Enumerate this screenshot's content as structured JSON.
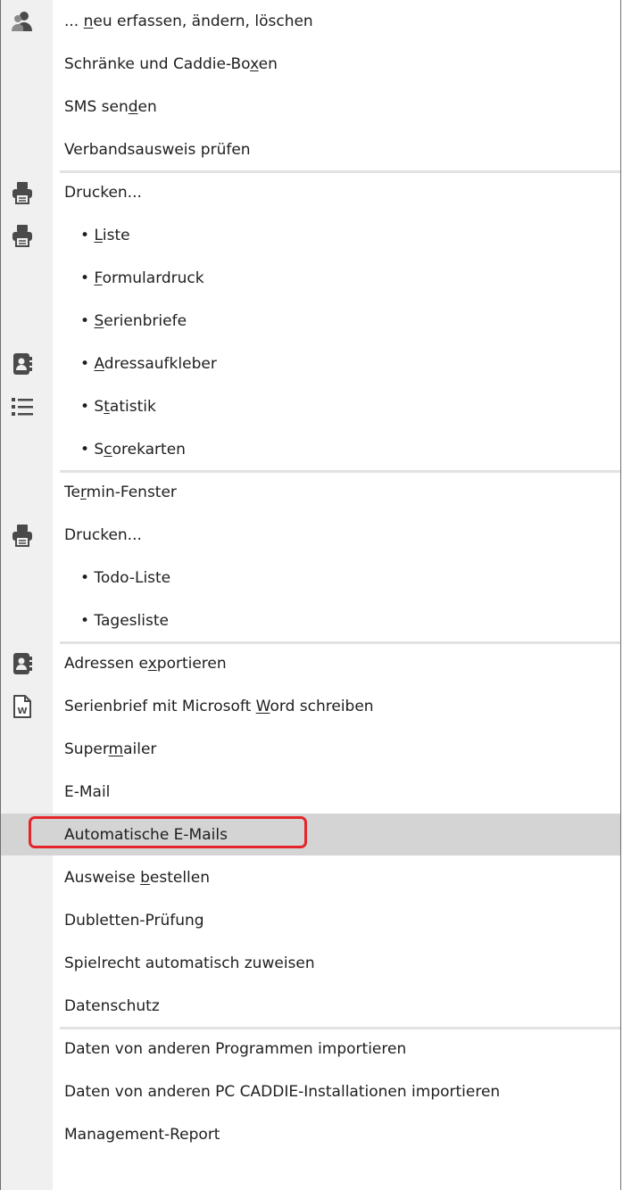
{
  "menu": {
    "items": [
      {
        "pre": "... ",
        "u": "n",
        "post": "eu erfassen, ändern, löschen",
        "icon": "users-icon"
      },
      {
        "pre": "Schränke und Caddie-Bo",
        "u": "x",
        "post": "en"
      },
      {
        "pre": "SMS sen",
        "u": "d",
        "post": "en"
      },
      {
        "pre": "Verbandsausweis prüfen",
        "u": "",
        "post": ""
      },
      {
        "pre": "Drucken...",
        "u": "",
        "post": "",
        "icon": "printer-icon",
        "sep_before": true
      },
      {
        "pre": "• ",
        "u": "L",
        "post": "iste",
        "icon": "printer-icon",
        "sub": true
      },
      {
        "pre": "• ",
        "u": "F",
        "post": "ormulardruck",
        "sub": true
      },
      {
        "pre": "• ",
        "u": "S",
        "post": "erienbriefe",
        "sub": true
      },
      {
        "pre": "• ",
        "u": "A",
        "post": "dressaufkleber",
        "icon": "address-book-icon",
        "sub": true
      },
      {
        "pre": "• S",
        "u": "t",
        "post": "atistik",
        "icon": "list-icon",
        "sub": true
      },
      {
        "pre": "• S",
        "u": "c",
        "post": "orekarten",
        "sub": true
      },
      {
        "pre": "Te",
        "u": "r",
        "post": "min-Fenster",
        "sep_before": true
      },
      {
        "pre": "Drucken...",
        "u": "",
        "post": "",
        "icon": "printer-icon"
      },
      {
        "pre": "• Todo-Liste",
        "u": "",
        "post": "",
        "sub": true
      },
      {
        "pre": "• Tagesliste",
        "u": "",
        "post": "",
        "sub": true
      },
      {
        "pre": "Adressen e",
        "u": "x",
        "post": "portieren",
        "icon": "address-book-icon",
        "sep_before": true
      },
      {
        "pre": "Serienbrief mit Microsoft ",
        "u": "W",
        "post": "ord schreiben",
        "icon": "word-doc-icon"
      },
      {
        "pre": "Super",
        "u": "m",
        "post": "ailer"
      },
      {
        "pre": "E-Mail",
        "u": "",
        "post": ""
      },
      {
        "pre": "Automatische E-Mails",
        "u": "",
        "post": "",
        "highlight": true
      },
      {
        "pre": "Ausweise ",
        "u": "b",
        "post": "estellen"
      },
      {
        "pre": "Dubletten-Prüfung",
        "u": "",
        "post": ""
      },
      {
        "pre": "Spielrecht automatisch zuweisen",
        "u": "",
        "post": ""
      },
      {
        "pre": "Datenschutz",
        "u": "",
        "post": ""
      },
      {
        "pre": "Daten von anderen Programmen importieren",
        "u": "",
        "post": "",
        "sep_before": true
      },
      {
        "pre": "Daten von anderen PC CADDIE-Installationen importieren",
        "u": "",
        "post": ""
      },
      {
        "pre": "Management-Report",
        "u": "",
        "post": ""
      }
    ]
  },
  "colors": {
    "gutter": "#f0f0f0",
    "highlight": "#d4d4d4",
    "highlight_border": "#e4262a",
    "icon": "#4a4a4a"
  }
}
